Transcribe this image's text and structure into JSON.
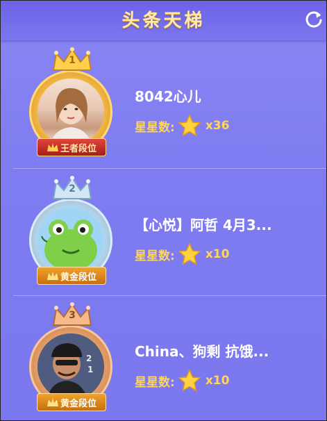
{
  "header": {
    "title": "头条天梯"
  },
  "entries": [
    {
      "rank": "1",
      "name": "8042心儿",
      "stars_label": "星星数:",
      "stars_count": "x36",
      "badge": "王者段位",
      "accent": "#f2b74a"
    },
    {
      "rank": "2",
      "name": "【心悦】阿哲 4月3...",
      "stars_label": "星星数:",
      "stars_count": "x10",
      "badge": "黄金段位",
      "accent": "#b9d6ea"
    },
    {
      "rank": "3",
      "name": "China、狗剩 抗饿...",
      "stars_label": "星星数:",
      "stars_count": "x10",
      "badge": "黄金段位",
      "accent": "#e5a06a"
    }
  ],
  "icons": {
    "refresh": "refresh-icon",
    "crown": "crown-icon",
    "star": "star-icon",
    "badge_crown": "small-crown-icon"
  },
  "colors": {
    "background": "#7f7cf1",
    "title": "#ffe9a6",
    "star_text": "#ffd55a",
    "name_text": "#ffffff"
  }
}
